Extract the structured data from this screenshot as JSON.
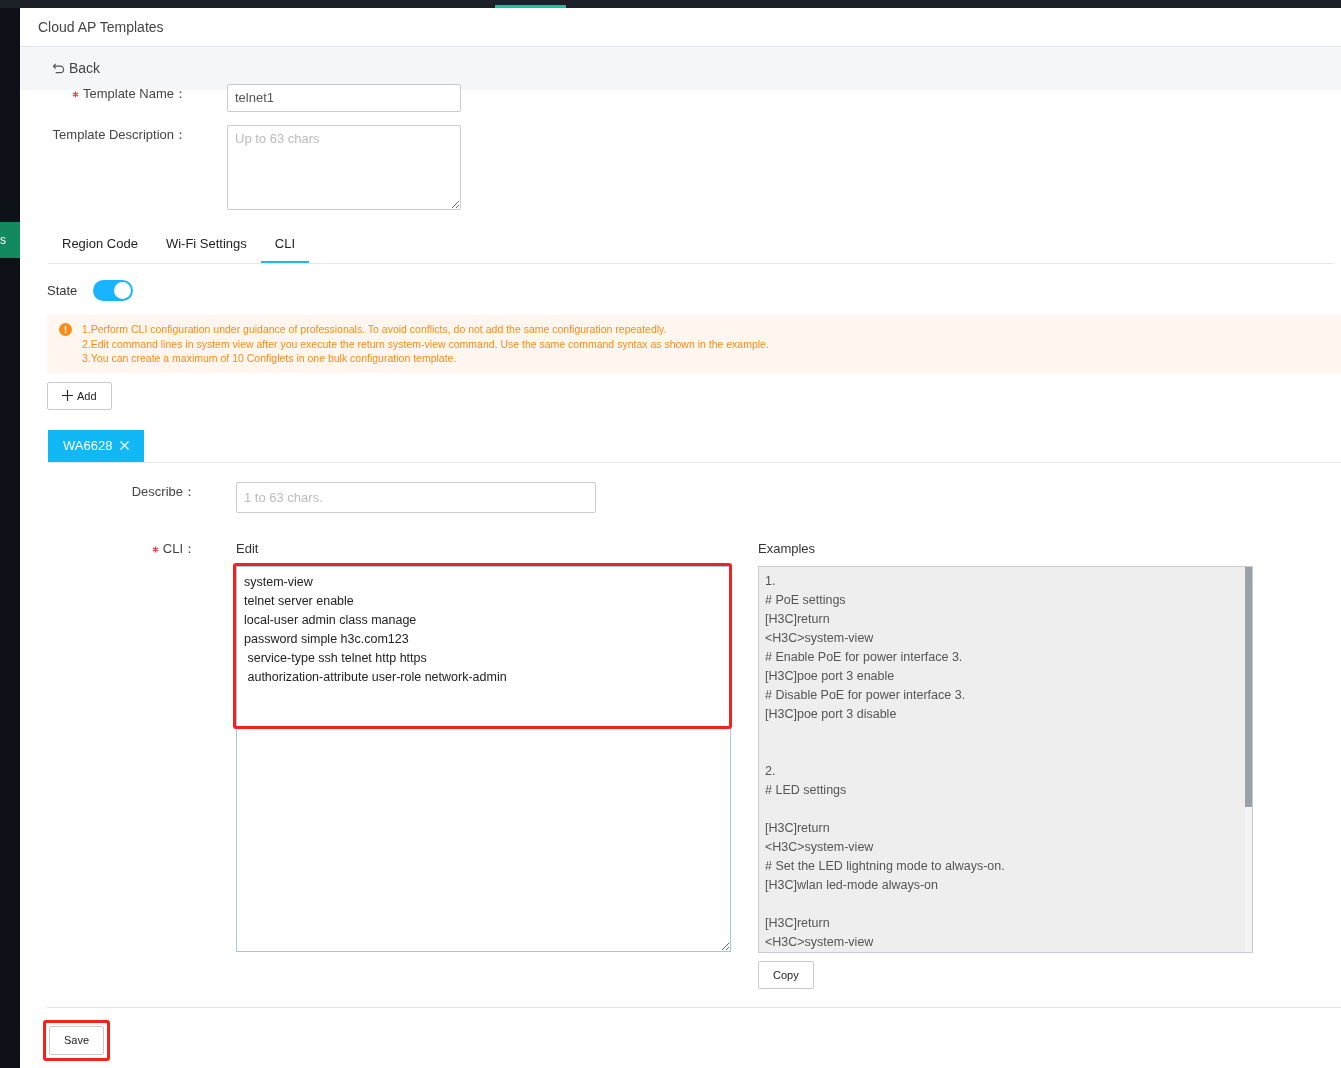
{
  "header": {
    "title": "Cloud AP Templates"
  },
  "back": {
    "label": "Back"
  },
  "sidebar": {
    "tab_label": "s"
  },
  "form": {
    "template_name": {
      "label": "Template Name：",
      "required": true,
      "value": "telnet1"
    },
    "template_description": {
      "label": "Template Description：",
      "placeholder": "Up to 63 chars"
    }
  },
  "tabs": [
    {
      "label": "Region Code",
      "selected": false
    },
    {
      "label": "Wi-Fi Settings",
      "selected": false
    },
    {
      "label": "CLI",
      "selected": true
    }
  ],
  "state": {
    "label": "State",
    "on": true
  },
  "notice": [
    "1.Perform CLI configuration under guidance of professionals. To avoid conflicts, do not add the same configuration repeatedly.",
    "2.Edit command lines in system view after you execute the return system-view command. Use the same command syntax as shown in the example.",
    "3.You can create a maximum of 10 Configlets in one bulk configuration template."
  ],
  "add_button": "Add",
  "configlet_tabs": [
    {
      "label": "WA6628",
      "selected": true
    }
  ],
  "describe": {
    "label": "Describe：",
    "placeholder": "1 to 63 chars."
  },
  "cli": {
    "label": "CLI：",
    "required": true,
    "edit_label": "Edit",
    "lines": [
      "system-view",
      "telnet server enable",
      "local-user admin class manage",
      "password simple h3c.com123",
      " service-type ssh telnet http https",
      " authorization-attribute user-role network-admin"
    ],
    "examples_label": "Examples",
    "examples": [
      {
        "kind": "section",
        "lines": [
          "1.",
          "# PoE settings",
          "[H3C]return",
          "<H3C>system-view",
          "# Enable PoE for power interface 3.",
          "[H3C]poe port 3 enable",
          "# Disable PoE for power interface 3.",
          "[H3C]poe port 3 disable"
        ]
      },
      {
        "kind": "section",
        "lines": [
          "2.",
          "# LED settings"
        ]
      },
      {
        "kind": "step",
        "lines": [
          "[H3C]return",
          "<H3C>system-view",
          "# Set the LED lightning mode to always-on.",
          "[H3C]wlan led-mode always-on"
        ]
      },
      {
        "kind": "step",
        "lines": [
          "[H3C]return",
          "<H3C>system-view"
        ]
      }
    ],
    "copy_button": "Copy"
  },
  "save_button": "Save"
}
